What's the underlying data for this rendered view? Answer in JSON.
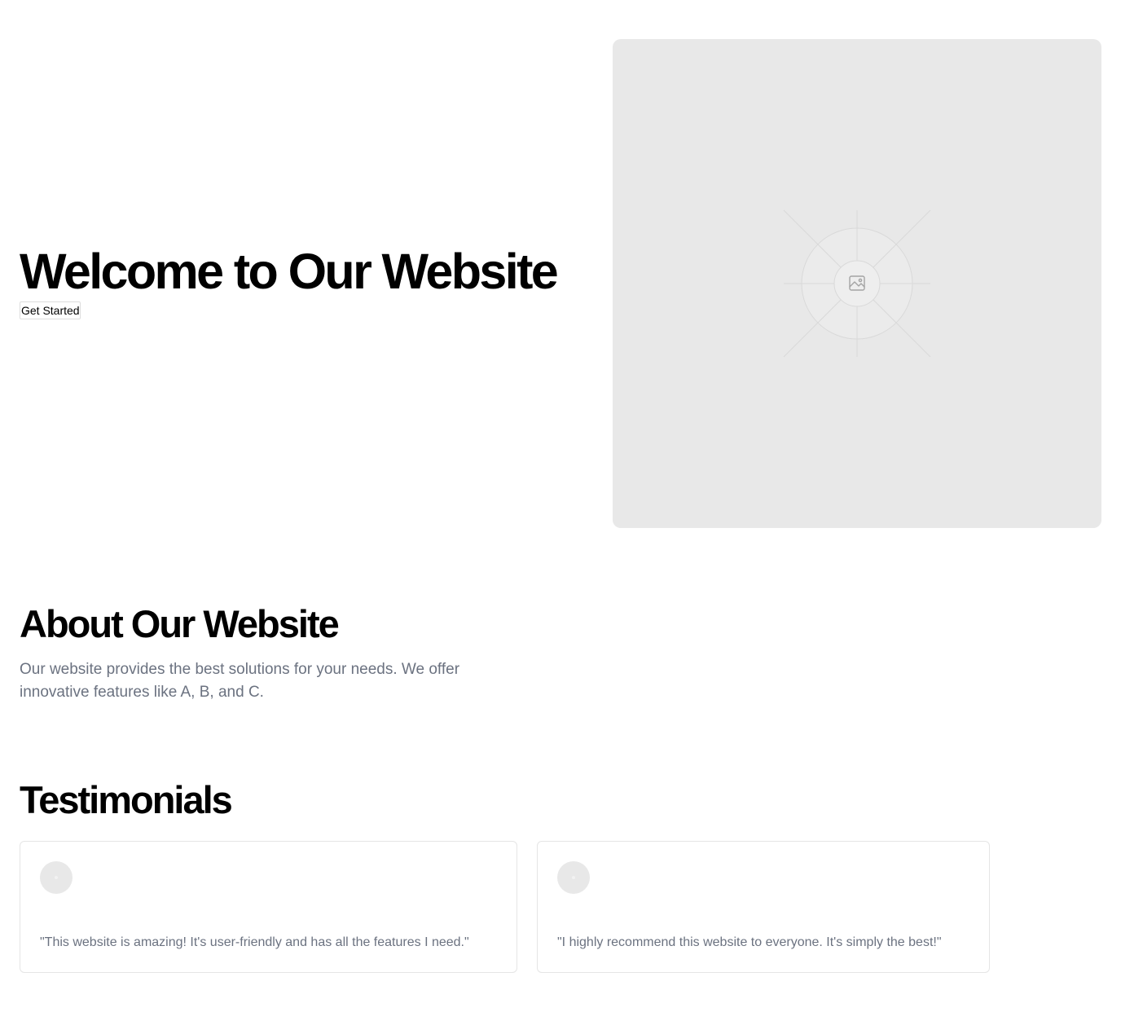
{
  "hero": {
    "title": "Welcome to Our Website",
    "cta_label": "Get Started",
    "image_icon": "image-placeholder-icon"
  },
  "about": {
    "title": "About Our Website",
    "text": "Our website provides the best solutions for your needs. We offer innovative features like A, B, and C."
  },
  "testimonials": {
    "title": "Testimonials",
    "items": [
      {
        "quote": "\"This website is amazing! It's user-friendly and has all the features I need.\"",
        "avatar_icon": "avatar-placeholder-icon"
      },
      {
        "quote": "\"I highly recommend this website to everyone. It's simply the best!\"",
        "avatar_icon": "avatar-placeholder-icon"
      }
    ]
  },
  "colors": {
    "text": "#000000",
    "muted_text": "#6b7280",
    "placeholder_bg": "#e8e8e8",
    "card_border": "#e5e5e5"
  }
}
